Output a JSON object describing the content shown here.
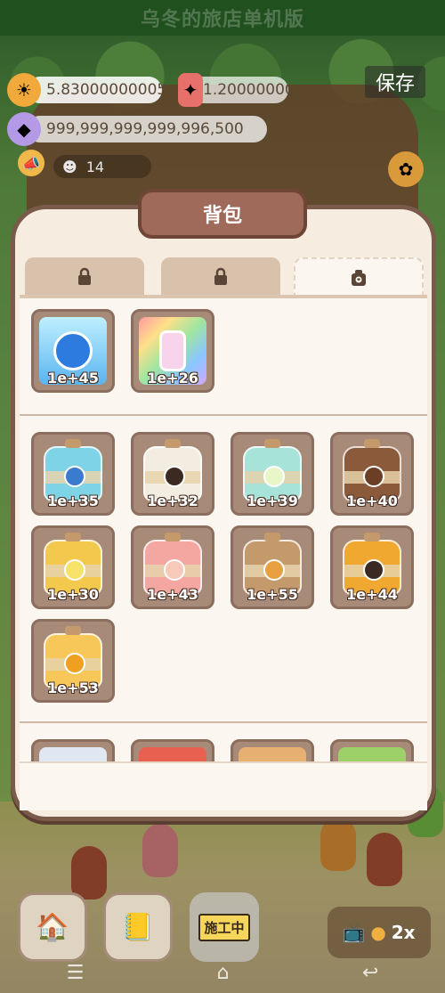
{
  "app": {
    "title": "乌冬的旅店单机版"
  },
  "resources": {
    "coins": "5.830000000053197e+20",
    "tickets": "1.2000000001e+21",
    "gems": "999,999,999,999,996,500"
  },
  "header": {
    "save_label": "保存",
    "visitor_count": "14"
  },
  "inventory": {
    "title": "背包",
    "tabs": [
      {
        "icon": "lock-icon",
        "active": false
      },
      {
        "icon": "lock-icon",
        "active": false
      },
      {
        "icon": "camera-bag-icon",
        "active": true
      }
    ],
    "special_items": [
      {
        "name": "blue-gift-bag",
        "count": "1e+45"
      },
      {
        "name": "rainbow-bottle",
        "count": "1e+26"
      }
    ],
    "jars": [
      {
        "count": "1e+35",
        "color": "#7fd3e6"
      },
      {
        "count": "1e+32",
        "color": "#f3ece0"
      },
      {
        "count": "1e+39",
        "color": "#a7e3d9"
      },
      {
        "count": "1e+40",
        "color": "#8a5a3a"
      },
      {
        "count": "1e+30",
        "color": "#f2c94c"
      },
      {
        "count": "1e+43",
        "color": "#f4a6a0"
      },
      {
        "count": "1e+55",
        "color": "#c49a6c"
      },
      {
        "count": "1e+44",
        "color": "#f0a830"
      },
      {
        "count": "1e+53",
        "color": "#f7c75a"
      }
    ]
  },
  "bottom": {
    "construction_label": "施工中",
    "speed_label": "2x"
  },
  "colors": {
    "panel_bg": "#f6ece0",
    "panel_border": "#7a5a4a",
    "title_bg": "#a06a5a",
    "slot_bg": "#a88a78"
  }
}
